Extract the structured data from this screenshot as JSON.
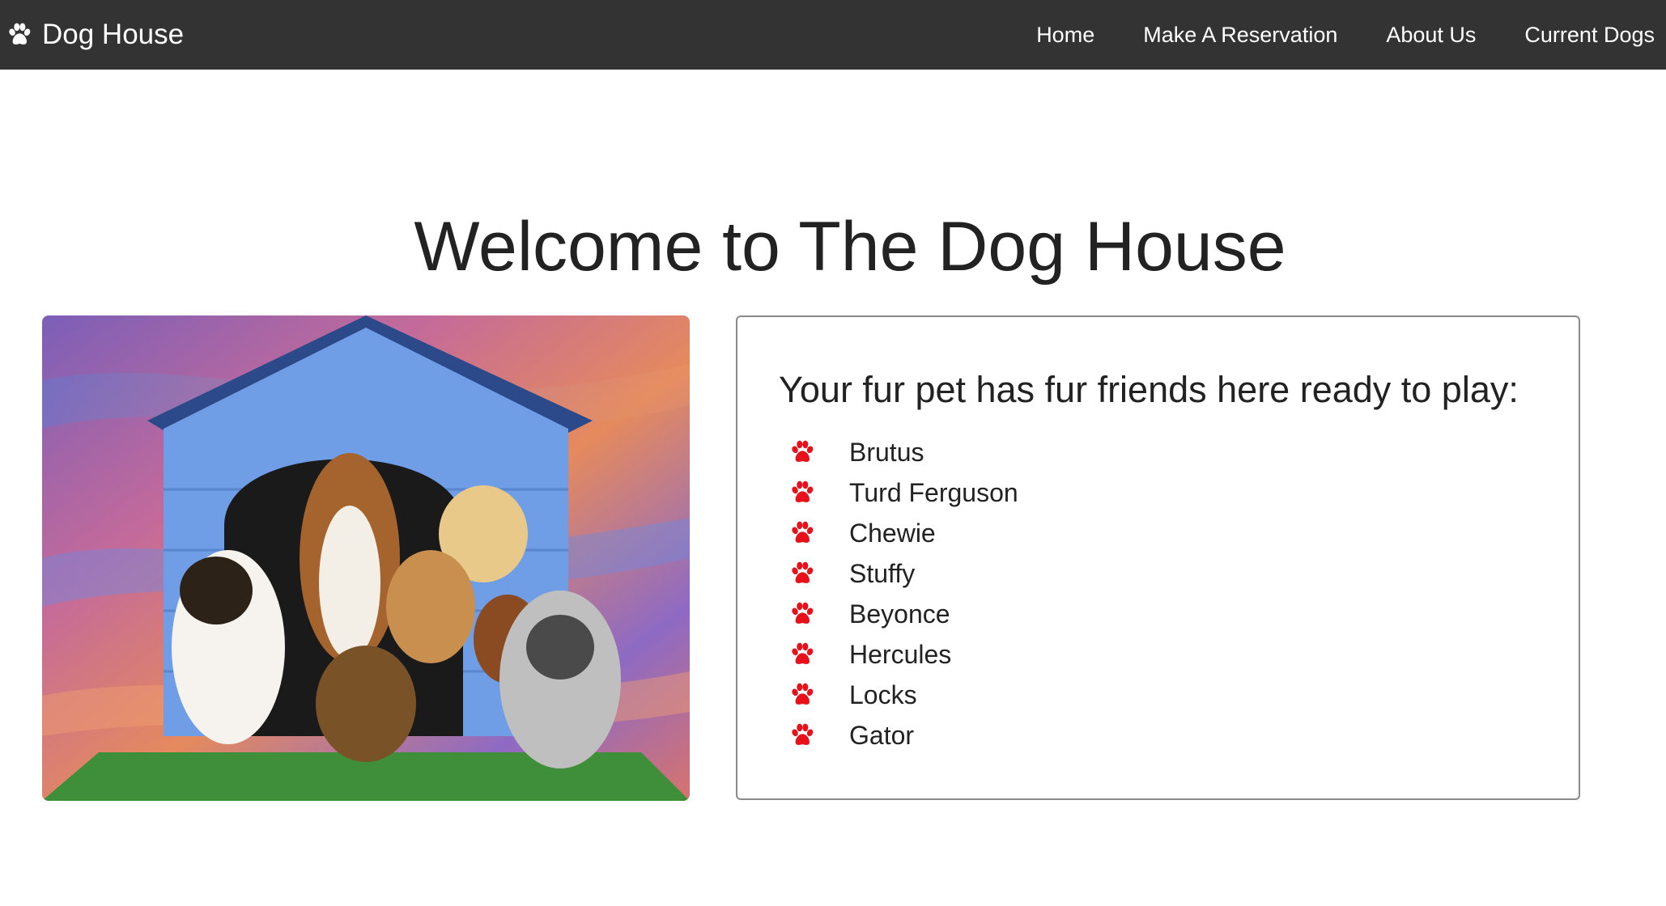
{
  "navbar": {
    "brand": "Dog House",
    "brand_icon": "paw-icon",
    "links": [
      {
        "label": "Home"
      },
      {
        "label": "Make A Reservation"
      },
      {
        "label": "About Us"
      },
      {
        "label": "Current Dogs"
      }
    ],
    "background": "#333333",
    "text_color": "#ffffff"
  },
  "hero": {
    "title": "Welcome to The Dog House"
  },
  "friends_card": {
    "heading": "Your fur pet has fur friends here ready to play:",
    "bullet_icon": "paw-icon",
    "bullet_color": "#e8101a",
    "dogs": [
      "Brutus",
      "Turd Ferguson",
      "Chewie",
      "Stuffy",
      "Beyonce",
      "Hercules",
      "Locks",
      "Gator"
    ]
  }
}
